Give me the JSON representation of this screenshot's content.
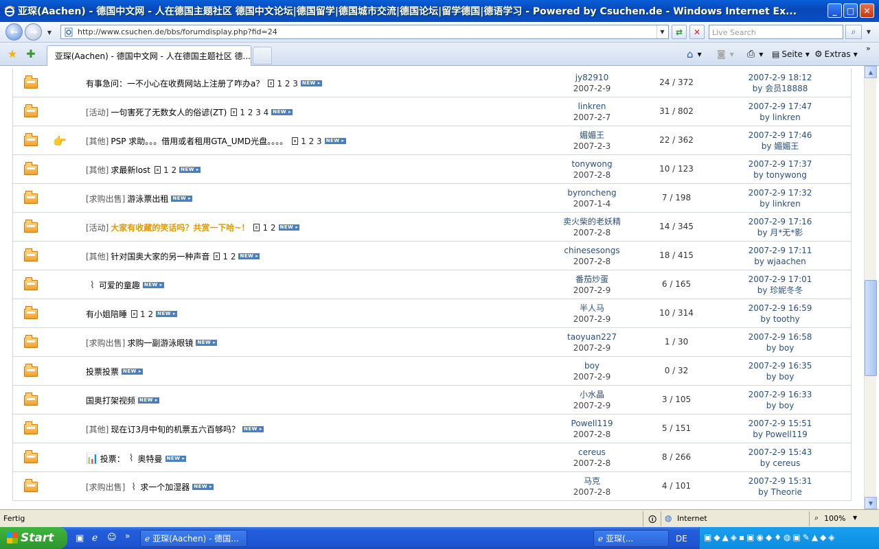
{
  "window": {
    "title": "亚琛(Aachen) - 德国中文网 - 人在德国主题社区 德国中文论坛|德国留学|德国城市交流|德国论坛|留学德国|德语学习 - Powered by Csuchen.de - Windows Internet Ex..."
  },
  "address": {
    "url": "http://www.csuchen.de/bbs/forumdisplay.php?fid=24"
  },
  "search": {
    "placeholder": "Live Search"
  },
  "tab": {
    "label": "亚琛(Aachen) - 德国中文网 - 人在德国主题社区 德..."
  },
  "commandbar": {
    "page": "Seite",
    "extras": "Extras"
  },
  "threads": [
    {
      "category": "",
      "title": "有事急问：一不小心在收费网站上注册了咋办a？",
      "pages": "1 2 3",
      "author": "jy82910",
      "date": "2007-2-9",
      "replies": "24",
      "views": "372",
      "last_time": "2007-2-9 18:12",
      "last_by": "by 会员18888"
    },
    {
      "category": "[活动]",
      "title": "一句害死了无数女人的俗谚(ZT)",
      "pages": "1 2 3 4",
      "author": "linkren",
      "date": "2007-2-7",
      "replies": "31",
      "views": "802",
      "last_time": "2007-2-9 17:47",
      "last_by": "by linkren"
    },
    {
      "category": "[其他]",
      "title": "PSP 求助。。。借用或者租用GTA_UMD光盘。。。。",
      "pages": "1 2 3",
      "author": "媚媚王",
      "date": "2007-2-3",
      "replies": "22",
      "views": "362",
      "last_time": "2007-2-9 17:46",
      "last_by": "by 媚媚王",
      "mood": "👉"
    },
    {
      "category": "[其他]",
      "title": "求最新lost",
      "pages": "1 2",
      "author": "tonywong",
      "date": "2007-2-8",
      "replies": "10",
      "views": "123",
      "last_time": "2007-2-9 17:37",
      "last_by": "by tonywong"
    },
    {
      "category": "[求购出售]",
      "title": "游泳票出租",
      "pages": "",
      "author": "byroncheng",
      "date": "2007-1-4",
      "replies": "7",
      "views": "198",
      "last_time": "2007-2-9 17:32",
      "last_by": "by linkren"
    },
    {
      "category": "[活动]",
      "title": "大家有收藏的笑话吗？共赏一下哈~！",
      "pages": "1 2",
      "author": "卖火柴的老妖精",
      "date": "2007-2-8",
      "replies": "14",
      "views": "345",
      "last_time": "2007-2-9 17:16",
      "last_by": "by 月*无*影",
      "highlight": true
    },
    {
      "category": "[其他]",
      "title": "针对国奥大家的另一种声音",
      "pages": "1 2",
      "author": "chinesesongs",
      "date": "2007-2-8",
      "replies": "18",
      "views": "415",
      "last_time": "2007-2-9 17:11",
      "last_by": "by wjaachen"
    },
    {
      "category": "",
      "title": "可爱的童趣",
      "pages": "",
      "author": "番茄炒蛋",
      "date": "2007-2-9",
      "replies": "6",
      "views": "165",
      "last_time": "2007-2-9 17:01",
      "last_by": "by 珍妮冬冬",
      "attach": true
    },
    {
      "category": "",
      "title": "有小姐陪睡",
      "pages": "1 2",
      "author": "半人马",
      "date": "2007-2-9",
      "replies": "10",
      "views": "314",
      "last_time": "2007-2-9 16:59",
      "last_by": "by toothy"
    },
    {
      "category": "[求购出售]",
      "title": "求购一副游泳眼镜",
      "pages": "",
      "author": "taoyuan227",
      "date": "2007-2-9",
      "replies": "1",
      "views": "30",
      "last_time": "2007-2-9 16:58",
      "last_by": "by boy"
    },
    {
      "category": "",
      "title": "投票投票",
      "pages": "",
      "author": "boy",
      "date": "2007-2-9",
      "replies": "0",
      "views": "32",
      "last_time": "2007-2-9 16:35",
      "last_by": "by boy"
    },
    {
      "category": "",
      "title": "国奥打架视频",
      "pages": "",
      "author": "小水晶",
      "date": "2007-2-9",
      "replies": "3",
      "views": "105",
      "last_time": "2007-2-9 16:33",
      "last_by": "by boy"
    },
    {
      "category": "[其他]",
      "title": "现在订3月中旬的机票五六百够吗？",
      "pages": "",
      "author": "Powell119",
      "date": "2007-2-8",
      "replies": "5",
      "views": "151",
      "last_time": "2007-2-9 15:51",
      "last_by": "by Powell119"
    },
    {
      "category": "",
      "title": "奥特曼",
      "pages": "",
      "author": "cereus",
      "date": "2007-2-8",
      "replies": "8",
      "views": "266",
      "last_time": "2007-2-9 15:43",
      "last_by": "by cereus",
      "poll": "投票：",
      "attach": true
    },
    {
      "category": "[求购出售]",
      "title": "求一个加湿器",
      "pages": "",
      "author": "马克",
      "date": "2007-2-8",
      "replies": "4",
      "views": "101",
      "last_time": "2007-2-9 15:31",
      "last_by": "by Theorie",
      "attach": true
    }
  ],
  "status": {
    "left": "Fertig",
    "zone": "Internet",
    "zoom": "100%"
  },
  "taskbar": {
    "start": "Start",
    "btn1": "亚琛(Aachen) - 德国...",
    "btn2": "亚琛(...",
    "lang": "DE"
  }
}
